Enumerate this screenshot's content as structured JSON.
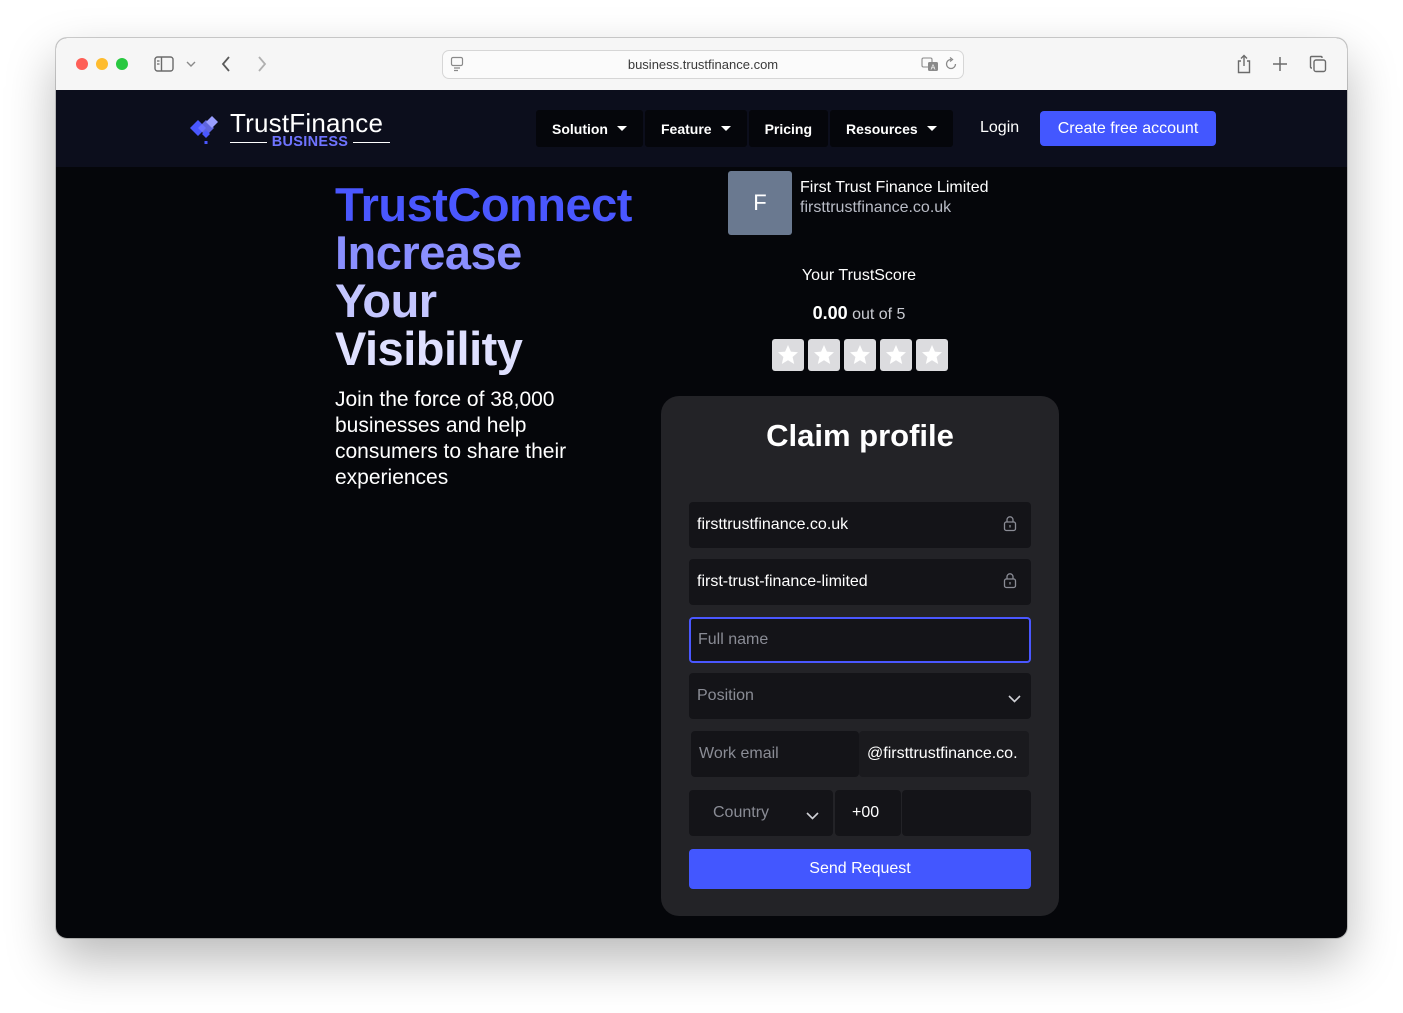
{
  "browser": {
    "url": "business.trustfinance.com"
  },
  "navbar": {
    "logo_title": "TrustFinance",
    "logo_subtitle": "BUSINESS",
    "menu": [
      {
        "label": "Solution",
        "has_caret": true
      },
      {
        "label": "Feature",
        "has_caret": true
      },
      {
        "label": "Pricing",
        "has_caret": false
      },
      {
        "label": "Resources",
        "has_caret": true
      }
    ],
    "login": "Login",
    "cta": "Create free account"
  },
  "hero": {
    "title_lines": [
      "TrustConnect",
      "Increase",
      "Your",
      "Visibility"
    ],
    "subtitle": "Join the force of 38,000 businesses and help consumers to share their experiences"
  },
  "company": {
    "avatar_letter": "F",
    "name": "First Trust Finance Limited",
    "domain": "firsttrustfinance.co.uk",
    "trustscore_label": "Your TrustScore",
    "score": "0.00",
    "score_suffix": "out of 5",
    "stars": 0,
    "max_stars": 5
  },
  "form": {
    "title": "Claim profile",
    "domain_value": "firsttrustfinance.co.uk",
    "slug_value": "first-trust-finance-limited",
    "full_name_placeholder": "Full name",
    "position_placeholder": "Position",
    "work_email_placeholder": "Work email",
    "email_suffix": "@firsttrustfinance.co.",
    "country_placeholder": "Country",
    "dial_code": "+00",
    "phone_value": "",
    "submit": "Send Request"
  },
  "colors": {
    "accent": "#4357ff",
    "background": "#05060a",
    "navbar": "#0c0e1c",
    "card": "#232327"
  }
}
